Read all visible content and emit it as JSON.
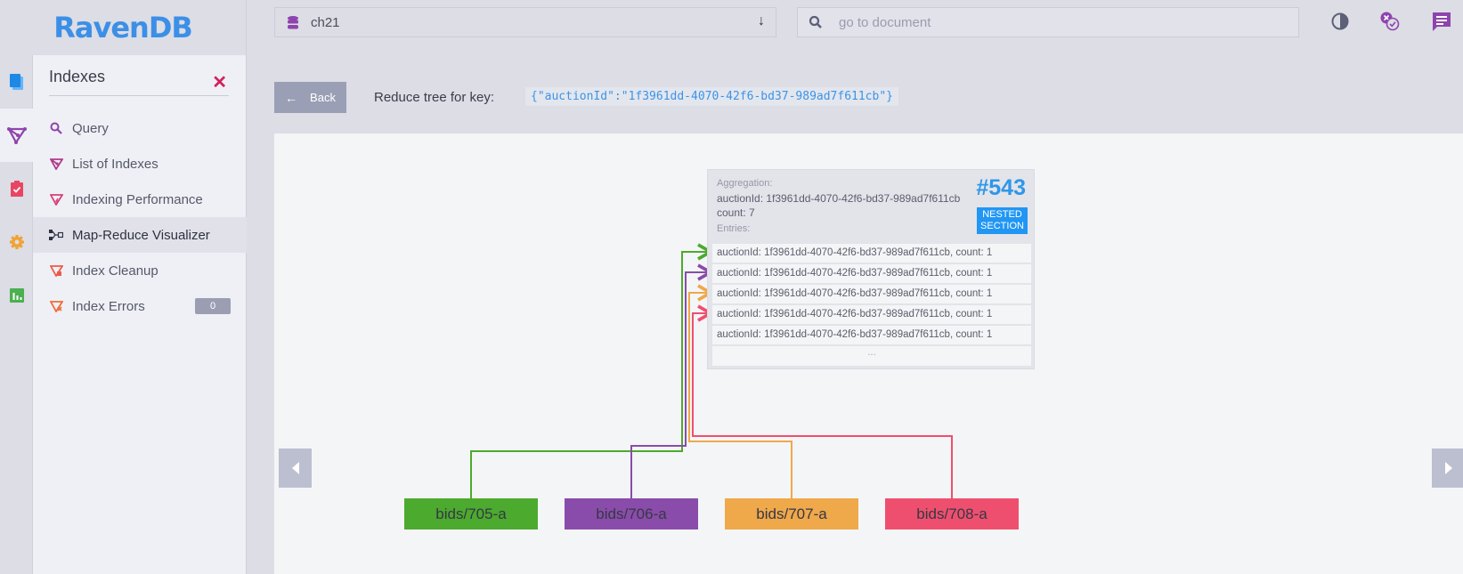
{
  "app": {
    "logo": "RavenDB"
  },
  "topbar": {
    "database": "ch21",
    "search_placeholder": "go to document",
    "icons": [
      "theme-toggle-icon",
      "notifications-icon",
      "feedback-icon"
    ]
  },
  "rail": {
    "items": [
      {
        "name": "documents",
        "icon": "documents-icon",
        "color": "#1e88e5"
      },
      {
        "name": "indexes",
        "icon": "indexes-icon",
        "color": "#8e44ad",
        "active": true
      },
      {
        "name": "tasks",
        "icon": "tasks-icon",
        "color": "#e94562"
      },
      {
        "name": "settings",
        "icon": "gear-icon",
        "color": "#f0a334"
      },
      {
        "name": "stats",
        "icon": "stats-icon",
        "color": "#4caf50"
      }
    ]
  },
  "sidebar": {
    "title": "Indexes",
    "items": [
      {
        "label": "Query",
        "icon": "search-icon"
      },
      {
        "label": "List of Indexes",
        "icon": "index-list-icon"
      },
      {
        "label": "Indexing Performance",
        "icon": "indexing-performance-icon"
      },
      {
        "label": "Map-Reduce Visualizer",
        "icon": "map-reduce-icon",
        "active": true
      },
      {
        "label": "Index Cleanup",
        "icon": "index-cleanup-icon"
      },
      {
        "label": "Index Errors",
        "icon": "index-errors-icon",
        "badge": "0"
      }
    ]
  },
  "main": {
    "back_label": "Back",
    "reduce_label": "Reduce tree for key:",
    "reduce_key": "{\"auctionId\":\"1f3961dd-4070-42f6-bd37-989ad7f611cb\"}",
    "aggregation": {
      "label": "Aggregation:",
      "key_line": "auctionId: 1f3961dd-4070-42f6-bd37-989ad7f611cb",
      "count_line": "count: 7",
      "entries_label": "Entries:",
      "page_number": "#543",
      "section_badge_line1": "NESTED",
      "section_badge_line2": "SECTION",
      "entries": [
        "auctionId: 1f3961dd-4070-42f6-bd37-989ad7f611cb, count: 1",
        "auctionId: 1f3961dd-4070-42f6-bd37-989ad7f611cb, count: 1",
        "auctionId: 1f3961dd-4070-42f6-bd37-989ad7f611cb, count: 1",
        "auctionId: 1f3961dd-4070-42f6-bd37-989ad7f611cb, count: 1",
        "auctionId: 1f3961dd-4070-42f6-bd37-989ad7f611cb, count: 1"
      ],
      "more": "..."
    },
    "documents": [
      {
        "id": "bids/705-a",
        "color": "#4caa2e"
      },
      {
        "id": "bids/706-a",
        "color": "#8a4caa"
      },
      {
        "id": "bids/707-a",
        "color": "#efa84a"
      },
      {
        "id": "bids/708-a",
        "color": "#ef4f6e"
      }
    ]
  }
}
